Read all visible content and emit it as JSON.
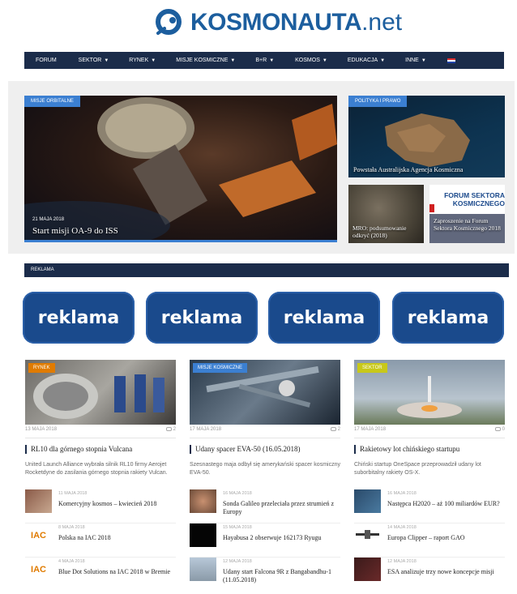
{
  "logo": {
    "word": "KOSMONAUTA",
    "suffix": ".net"
  },
  "nav": [
    {
      "label": "FORUM",
      "has_dropdown": false
    },
    {
      "label": "SEKTOR",
      "has_dropdown": true
    },
    {
      "label": "RYNEK",
      "has_dropdown": true
    },
    {
      "label": "MISJE KOSMICZNE",
      "has_dropdown": true
    },
    {
      "label": "B+R",
      "has_dropdown": true
    },
    {
      "label": "KOSMOS",
      "has_dropdown": true
    },
    {
      "label": "EDUKACJA",
      "has_dropdown": true
    },
    {
      "label": "INNE",
      "has_dropdown": true
    }
  ],
  "hero": {
    "main": {
      "category": "MISJE ORBITALNE",
      "date": "21 MAJA 2018",
      "title": "Start misji OA-9 do ISS"
    },
    "top_right": {
      "category": "POLITYKA I PRAWO",
      "title": "Powstała Australijska Agencja Kosmiczna"
    },
    "bottom_left": {
      "title": "MRO: podsumowanie odkryć (2018)"
    },
    "bottom_right": {
      "banner": "FORUM SEKTORA KOSMICZNEGO",
      "title": "Zaproszenie na Forum Sektora Kosmicznego 2018"
    }
  },
  "reklama": {
    "label": "REKLAMA",
    "ads": [
      "reklama",
      "reklama",
      "reklama",
      "reklama"
    ]
  },
  "columns": [
    {
      "category": "RYNEK",
      "category_color": "#e07b00",
      "date": "13 MAJA 2018",
      "comments": "2",
      "title": "RL10 dla górnego stopnia Vulcana",
      "desc": "United Launch Alliance wybrała silnik RL10 firmy Aerojet Rocketdyne do zasilania górnego stopnia rakiety Vulcan.",
      "items": [
        {
          "date": "11 MAJA 2018",
          "title": "Komercyjny kosmos – kwiecień 2018",
          "thumb": "photo"
        },
        {
          "date": "8 MAJA 2018",
          "title": "Polska na IAC 2018",
          "thumb": "iac"
        },
        {
          "date": "4 MAJA 2018",
          "title": "Blue Dot Solutions na IAC 2018 w Bremie",
          "thumb": "iac"
        }
      ]
    },
    {
      "category": "MISJE KOSMICZNE",
      "category_color": "#3b7fd1",
      "date": "17 MAJA 2018",
      "comments": "2",
      "title": "Udany spacer EVA-50 (16.05.2018)",
      "desc": "Szesnastego maja odbył się amerykański spacer kosmiczny EVA-50.",
      "items": [
        {
          "date": "16 MAJA 2018",
          "title": "Sonda Galileo przeleciała przez strumień z Europy",
          "thumb": "photo"
        },
        {
          "date": "15 MAJA 2018",
          "title": "Hayabusa 2 obserwuje 162173 Ryugu",
          "thumb": "dark"
        },
        {
          "date": "12 MAJA 2018",
          "title": "Udany start Falcona 9R z Bangabandhu-1 (11.05.2018)",
          "thumb": "launch"
        }
      ]
    },
    {
      "category": "SEKTOR",
      "category_color": "#c8c81a",
      "date": "17 MAJA 2018",
      "comments": "0",
      "title": "Rakietowy lot chińskiego startupu",
      "desc": "Chiński startup OneSpace przeprowadził udany lot suborbitalny rakiety OS-X.",
      "items": [
        {
          "date": "16 MAJA 2018",
          "title": "Następca H2020 – aż 100 miliardów EUR?",
          "thumb": "map"
        },
        {
          "date": "14 MAJA 2018",
          "title": "Europa Clipper – raport GAO",
          "thumb": "probe"
        },
        {
          "date": "12 MAJA 2018",
          "title": "ESA analizuje trzy nowe koncepcje misji",
          "thumb": "dark"
        }
      ]
    }
  ]
}
